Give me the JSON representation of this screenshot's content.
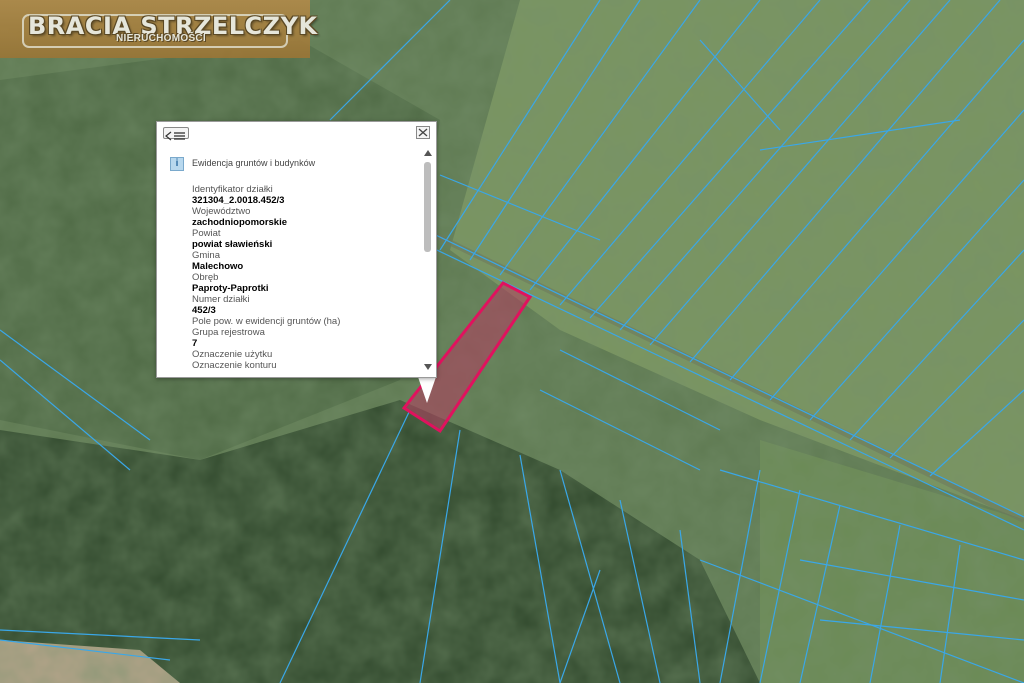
{
  "logo": {
    "brand": "BRACIA STRZELCZYK",
    "subtitle": "NIERUCHOMOŚCI"
  },
  "popup": {
    "back_icon": "list-back-icon",
    "close_icon": "close-icon",
    "info_icon": "info-icon",
    "section_title": "Ewidencja gruntów i budynków",
    "fields": [
      {
        "label": "Identyfikator działki",
        "value": "321304_2.0018.452/3"
      },
      {
        "label": "Województwo",
        "value": "zachodniopomorskie"
      },
      {
        "label": "Powiat",
        "value": "powiat sławieński"
      },
      {
        "label": "Gmina",
        "value": "Malechowo"
      },
      {
        "label": "Obręb",
        "value": "Paproty-Paprotki"
      },
      {
        "label": "Numer działki",
        "value": "452/3"
      },
      {
        "label": "Pole pow. w ewidencji gruntów (ha)",
        "value": ""
      },
      {
        "label": "Grupa rejestrowa",
        "value": "7"
      },
      {
        "label": "Oznaczenie użytku",
        "value": ""
      },
      {
        "label": "Oznaczenie konturu",
        "value": ""
      }
    ]
  },
  "colors": {
    "parcel_line": "#3aa7e8",
    "highlight_stroke": "#e0125e",
    "highlight_fill": "#b43c60"
  }
}
